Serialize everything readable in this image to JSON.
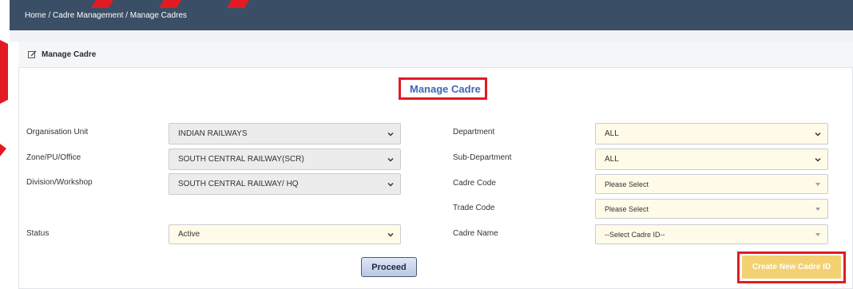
{
  "breadcrumb": {
    "home": "Home",
    "sep1": " / ",
    "section": "Cadre Management",
    "sep2": " / ",
    "page": "Manage Cadres"
  },
  "panel": {
    "title": "Manage Cadre",
    "center_title": "Manage Cadre"
  },
  "left_form": {
    "organisation_unit": {
      "label": "Organisation Unit",
      "value": "INDIAN RAILWAYS"
    },
    "zone": {
      "label": "Zone/PU/Office",
      "value": "SOUTH CENTRAL RAILWAY(SCR)"
    },
    "division": {
      "label": "Division/Workshop",
      "value": "SOUTH CENTRAL RAILWAY/ HQ"
    },
    "status": {
      "label": "Status",
      "value": "Active"
    }
  },
  "right_form": {
    "department": {
      "label": "Department",
      "value": "ALL"
    },
    "sub_department": {
      "label": "Sub-Department",
      "value": "ALL"
    },
    "cadre_code": {
      "label": "Cadre Code",
      "value": "Please Select"
    },
    "trade_code": {
      "label": "Trade Code",
      "value": "Please Select"
    },
    "cadre_name": {
      "label": "Cadre Name",
      "value": "--Select Cadre ID--"
    }
  },
  "buttons": {
    "proceed": "Proceed",
    "create_new": "Create New Cadre ID"
  },
  "colors": {
    "topbar": "#3a4f66",
    "title_blue": "#3d68b8",
    "highlight_red": "#e21b23",
    "create_btn": "#f3d071",
    "cream_field": "#fffbe8"
  },
  "icons": {
    "panel_icon": "edit-icon",
    "dropdown": "chevron-down-icon"
  }
}
